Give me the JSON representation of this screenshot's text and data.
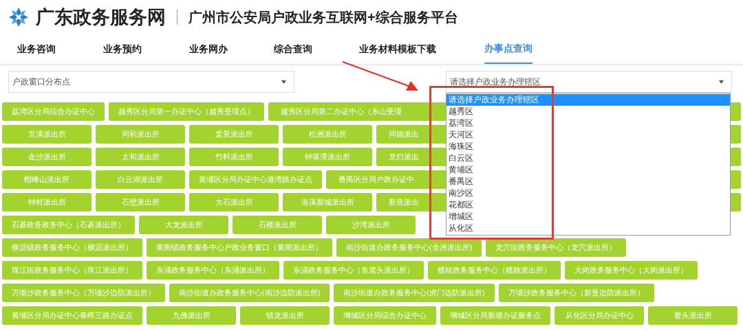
{
  "header": {
    "site_name": "广东政务服务网",
    "platform_title": "广州市公安局户政业务互联网+综合服务平台"
  },
  "nav": [
    {
      "label": "业务咨询",
      "selected": false
    },
    {
      "label": "业务预约",
      "selected": false
    },
    {
      "label": "业务网办",
      "selected": false
    },
    {
      "label": "综合查询",
      "selected": false
    },
    {
      "label": "业务材料模板下载",
      "selected": false
    },
    {
      "label": "办事点查询",
      "selected": true
    }
  ],
  "filters": {
    "category_select": "户政窗口分布点",
    "district_select": "请选择户政业务办理辖区"
  },
  "district_options": [
    {
      "label": "请选择户政业务办理辖区",
      "selected": true
    },
    {
      "label": "越秀区",
      "selected": false
    },
    {
      "label": "荔湾区",
      "selected": false
    },
    {
      "label": "天河区",
      "selected": false
    },
    {
      "label": "海珠区",
      "selected": false
    },
    {
      "label": "白云区",
      "selected": false
    },
    {
      "label": "黄埔区",
      "selected": false
    },
    {
      "label": "番禺区",
      "selected": false
    },
    {
      "label": "南沙区",
      "selected": false
    },
    {
      "label": "花都区",
      "selected": false
    },
    {
      "label": "增城区",
      "selected": false
    },
    {
      "label": "从化区",
      "selected": false
    }
  ],
  "office_rows": [
    [
      {
        "label": "荔湾区分局综合办证中心",
        "kind": "full"
      },
      {
        "label": "越秀区分局第一办证中心（越秀受理点）",
        "kind": "full"
      },
      {
        "label": "越秀区分局第二办证中心（东山受理",
        "kind": "partial"
      }
    ],
    [
      {
        "label": "京溪派出所",
        "kind": "full"
      },
      {
        "label": "同和派出所",
        "kind": "full"
      },
      {
        "label": "棠景派出所",
        "kind": "full"
      },
      {
        "label": "松洲派出所",
        "kind": "full"
      },
      {
        "label": "同德派出",
        "kind": "partial"
      }
    ],
    [
      {
        "label": "金沙派出所",
        "kind": "full"
      },
      {
        "label": "太和派出所",
        "kind": "full"
      },
      {
        "label": "竹料派出所",
        "kind": "full"
      },
      {
        "label": "钟落潭派出所",
        "kind": "full"
      },
      {
        "label": "龙归派出",
        "kind": "partial"
      }
    ],
    [
      {
        "label": "帽峰山派出所",
        "kind": "full"
      },
      {
        "label": "白云湖派出所",
        "kind": "full"
      },
      {
        "label": "黄埔区分局办证中心港湾路办证点",
        "kind": "full"
      },
      {
        "label": "番禺区分局户政办证中",
        "kind": "partial"
      }
    ],
    [
      {
        "label": "钟村派出所",
        "kind": "full"
      },
      {
        "label": "石壁派出所",
        "kind": "full"
      },
      {
        "label": "大石派出所",
        "kind": "full"
      },
      {
        "label": "洛溪新城派出所",
        "kind": "full"
      },
      {
        "label": "新造派出",
        "kind": "partial"
      }
    ],
    [
      {
        "label": "石碁政务政务中心（石碁派出所）",
        "kind": "full"
      },
      {
        "label": "大龙派出所",
        "kind": "full"
      },
      {
        "label": "石楼派出所",
        "kind": "full"
      },
      {
        "label": "沙湾派出所",
        "kind": "full"
      }
    ],
    [
      {
        "label": "横沥镇政务服务中心（横沥派出所）",
        "kind": "full"
      },
      {
        "label": "黄阁镇政务服务中心户政业务窗口（黄阁派出所）",
        "kind": "full"
      },
      {
        "label": "南沙街道办政务服务中心(金洲派出所)",
        "kind": "full"
      },
      {
        "label": "龙穴街政务服务中心（龙穴派出所）",
        "kind": "full"
      }
    ],
    [
      {
        "label": "珠江街政务服务中心（珠江派出所）",
        "kind": "full"
      },
      {
        "label": "东涌政务服务中心（东涌派出所）",
        "kind": "full"
      },
      {
        "label": "东涌政务服务中心（鱼窝头派出所）",
        "kind": "full"
      },
      {
        "label": "榄核政务服务中心（榄核派出所）",
        "kind": "full"
      },
      {
        "label": "大岗政务服务中心（大岗派出所）",
        "kind": "full"
      }
    ],
    [
      {
        "label": "万顷沙政务服务中心（万顷沙边防派出所）",
        "kind": "full"
      },
      {
        "label": "南沙街道办政务服务中心(南沙边防派出所)",
        "kind": "full"
      },
      {
        "label": "南沙街道办政务服务中心(虎门边防派出所)",
        "kind": "full"
      },
      {
        "label": "万顷沙政务服务中心（新垦边防派出所）",
        "kind": "full"
      }
    ],
    [
      {
        "label": "黄埔区分局办证中心春晖三路办证点",
        "kind": "full"
      },
      {
        "label": "九佛派出所",
        "kind": "full"
      },
      {
        "label": "镇龙派出所",
        "kind": "full"
      },
      {
        "label": "增城区分局综合办证中心",
        "kind": "full"
      },
      {
        "label": "增城区分局新塘办证服务点",
        "kind": "full"
      },
      {
        "label": "从化区分局办证中心",
        "kind": "full"
      },
      {
        "label": "鳌头派出所",
        "kind": "full"
      }
    ]
  ]
}
